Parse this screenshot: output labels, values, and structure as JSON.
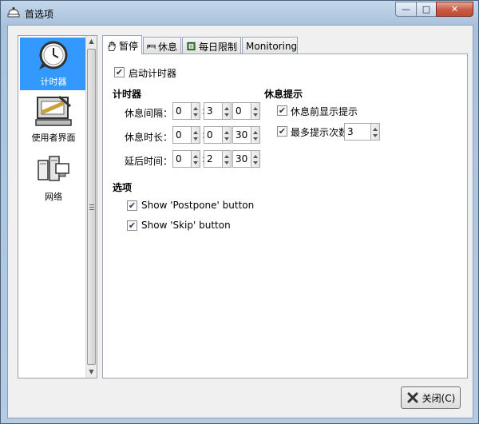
{
  "window": {
    "title": "首选项",
    "min_glyph": "—",
    "max_glyph": "□",
    "close_glyph": "✕"
  },
  "sidebar": {
    "items": [
      {
        "label": "计时器",
        "icon": "timer-clock-icon",
        "selected": true
      },
      {
        "label": "使用者界面",
        "icon": "user-interface-icon",
        "selected": false
      },
      {
        "label": "网络",
        "icon": "network-icon",
        "selected": false
      }
    ]
  },
  "tabs": [
    {
      "label": "暂停",
      "icon": "hand-icon",
      "active": true
    },
    {
      "label": "休息",
      "icon": "bed-icon",
      "active": false
    },
    {
      "label": "每日限制",
      "icon": "book-icon",
      "active": false
    },
    {
      "label": "Monitoring",
      "icon": "",
      "active": false
    }
  ],
  "panel": {
    "enable_timer": {
      "label": "启动计时器",
      "checked": true
    },
    "timer_section": {
      "heading": "计时器",
      "rows": [
        {
          "label": "休息间隔：",
          "values": [
            "0",
            "3",
            "0"
          ]
        },
        {
          "label": "休息时长：",
          "values": [
            "0",
            "0",
            "30"
          ]
        },
        {
          "label": "延后时间：",
          "values": [
            "0",
            "2",
            "30"
          ]
        }
      ]
    },
    "reminder_section": {
      "heading": "休息提示",
      "show_before": {
        "label": "休息前显示提示",
        "checked": true
      },
      "max_prompts": {
        "label": "最多提示次数",
        "checked": true,
        "value": "3"
      }
    },
    "options_section": {
      "heading": "选项",
      "items": [
        {
          "label": "Show 'Postpone' button",
          "checked": true
        },
        {
          "label": "Show 'Skip' button",
          "checked": true
        }
      ]
    },
    "check_glyph": "✔",
    "colon": ":"
  },
  "footer": {
    "close_label": "关闭(C)"
  }
}
